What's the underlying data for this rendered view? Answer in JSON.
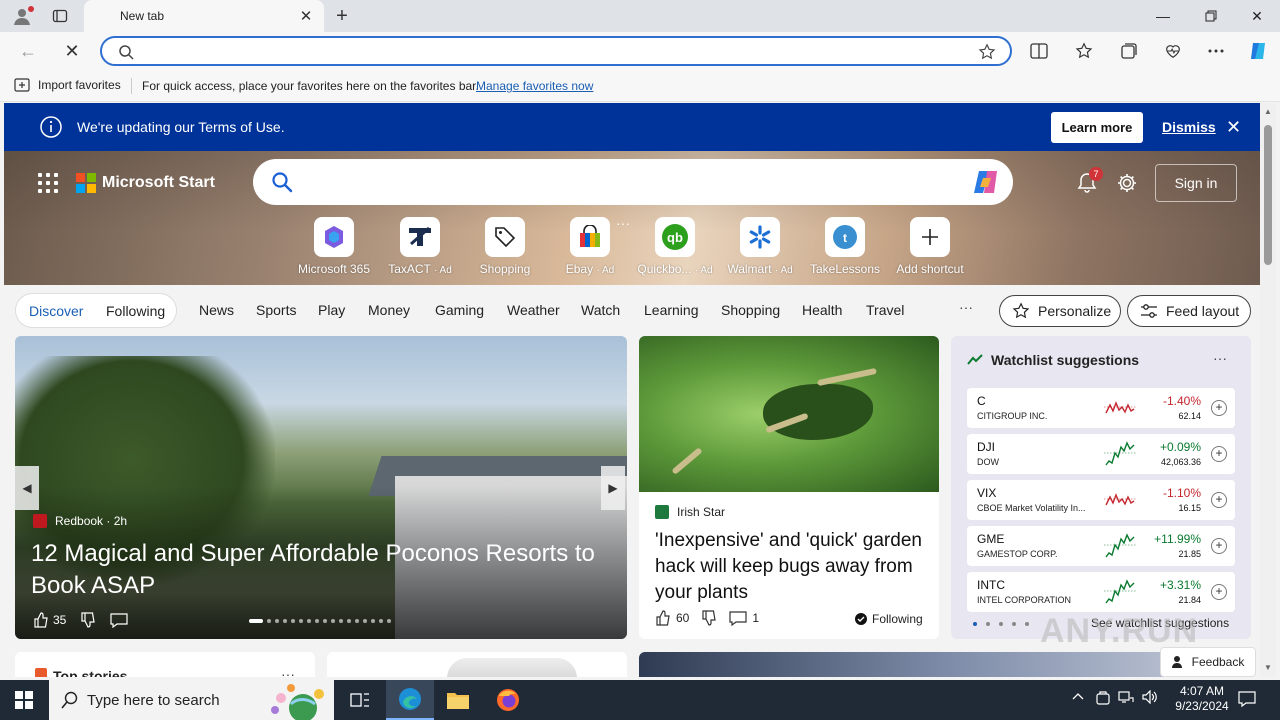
{
  "browser": {
    "tab_title": "New tab",
    "favorites_bar": {
      "import_label": "Import favorites",
      "hint": "For quick access, place your favorites here on the favorites bar.",
      "manage_link": "Manage favorites now"
    }
  },
  "banner": {
    "text": "We're updating our Terms of Use.",
    "learn_more": "Learn more",
    "dismiss": "Dismiss"
  },
  "header": {
    "brand": "Microsoft Start",
    "notification_count": "7",
    "sign_in": "Sign in"
  },
  "shortcuts": [
    {
      "label": "Microsoft 365",
      "ad": ""
    },
    {
      "label": "TaxACT",
      "ad": "· Ad"
    },
    {
      "label": "Shopping",
      "ad": ""
    },
    {
      "label": "Ebay",
      "ad": "· Ad"
    },
    {
      "label": "Quickbo...",
      "ad": "· Ad"
    },
    {
      "label": "Walmart",
      "ad": "· Ad"
    },
    {
      "label": "TakeLessons",
      "ad": ""
    },
    {
      "label": "Add shortcut",
      "ad": ""
    }
  ],
  "nav": {
    "discover": "Discover",
    "following": "Following",
    "items": [
      "News",
      "Sports",
      "Play",
      "Money",
      "Gaming",
      "Weather",
      "Watch",
      "Learning",
      "Shopping",
      "Health",
      "Travel"
    ],
    "more": "···",
    "personalize": "Personalize",
    "feed_layout": "Feed layout"
  },
  "main_story": {
    "source": "Redbook · 2h",
    "title": "12 Magical and Super Affordable Poconos Resorts to Book ASAP",
    "likes": "35"
  },
  "second_story": {
    "source": "Irish Star",
    "title": "'Inexpensive' and 'quick' garden hack will keep bugs away from your plants",
    "likes": "60",
    "comments": "1",
    "following": "Following"
  },
  "watchlist": {
    "title": "Watchlist suggestions",
    "more": "···",
    "stocks": [
      {
        "ticker": "C",
        "name": "CITIGROUP INC.",
        "change": "-1.40%",
        "price": "62.14",
        "direction": "down"
      },
      {
        "ticker": "DJI",
        "name": "DOW",
        "change": "+0.09%",
        "price": "42,063.36",
        "direction": "up"
      },
      {
        "ticker": "VIX",
        "name": "CBOE Market Volatility In...",
        "change": "-1.10%",
        "price": "16.15",
        "direction": "down"
      },
      {
        "ticker": "GME",
        "name": "GAMESTOP CORP.",
        "change": "+11.99%",
        "price": "21.85",
        "direction": "up"
      },
      {
        "ticker": "INTC",
        "name": "INTEL CORPORATION",
        "change": "+3.31%",
        "price": "21.84",
        "direction": "up"
      }
    ],
    "see_more": "See watchlist suggestions"
  },
  "lower": {
    "top_stories": "Top stories",
    "feedback": "Feedback"
  },
  "watermark": "ANY.RUN",
  "taskbar": {
    "search_placeholder": "Type here to search",
    "time": "4:07 AM",
    "date": "9/23/2024"
  },
  "colors": {
    "banner": "#003399",
    "accent": "#2f6fd1",
    "stock_up": "#0a7a2f",
    "stock_down": "#c4262e"
  }
}
